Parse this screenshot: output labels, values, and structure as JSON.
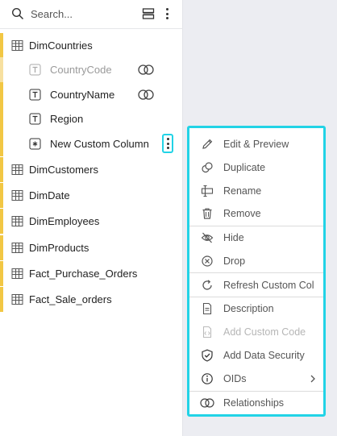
{
  "search": {
    "placeholder": "Search..."
  },
  "tree": {
    "dim_countries": "DimCountries",
    "columns": {
      "country_code": "CountryCode",
      "country_name": "CountryName",
      "region": "Region",
      "custom": "New Custom Column"
    },
    "tables": [
      "DimCustomers",
      "DimDate",
      "DimEmployees",
      "DimProducts",
      "Fact_Purchase_Orders",
      "Fact_Sale_orders"
    ]
  },
  "menu": {
    "edit_preview": "Edit & Preview",
    "duplicate": "Duplicate",
    "rename": "Rename",
    "remove": "Remove",
    "hide": "Hide",
    "drop": "Drop",
    "refresh": "Refresh Custom Col",
    "description": "Description",
    "add_custom_code": "Add Custom Code",
    "add_data_security": "Add Data Security",
    "oids": "OIDs",
    "relationships": "Relationships"
  },
  "colors": {
    "accent_yellow": "#f2c744",
    "highlight_cyan": "#22d3e6"
  }
}
